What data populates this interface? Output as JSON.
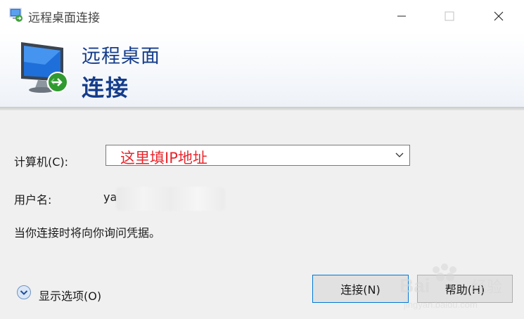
{
  "window": {
    "title": "远程桌面连接"
  },
  "banner": {
    "line1": "远程桌面",
    "line2": "连接"
  },
  "form": {
    "computer_label": "计算机(C):",
    "computer_value": "这里填IP地址",
    "username_label": "用户名:",
    "username_value": "ya",
    "credentials_note": "当你连接时将向你询问凭据。"
  },
  "footer": {
    "show_options": "显示选项(O)",
    "connect_button": "连接(N)",
    "help_button": "帮助(H)"
  },
  "colors": {
    "banner_text": "#143c8c",
    "annotation_red": "#e8262c"
  },
  "icons": [
    "remote-desktop-icon",
    "minimize-icon",
    "maximize-icon",
    "close-icon",
    "chevron-down-icon",
    "expand-options-icon"
  ]
}
